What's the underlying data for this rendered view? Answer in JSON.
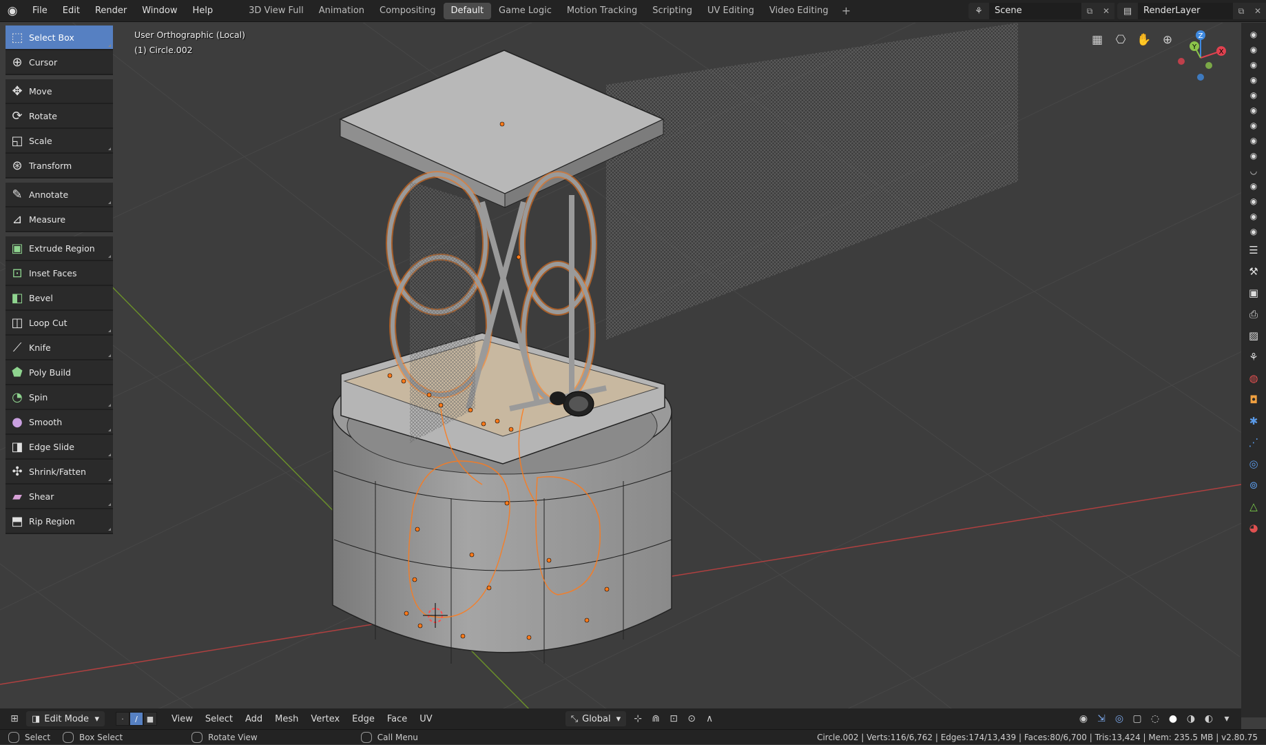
{
  "menu": {
    "items": [
      "File",
      "Edit",
      "Render",
      "Window",
      "Help"
    ]
  },
  "workspaces": {
    "tabs": [
      "3D View Full",
      "Animation",
      "Compositing",
      "Default",
      "Game Logic",
      "Motion Tracking",
      "Scripting",
      "UV Editing",
      "Video Editing"
    ],
    "active": "Default",
    "add_label": "+"
  },
  "scene": {
    "name": "Scene"
  },
  "render_layer": {
    "name": "RenderLayer"
  },
  "viewport": {
    "view_name": "User Orthographic (Local)",
    "object_name": "(1) Circle.002"
  },
  "toolbar": {
    "tools": [
      {
        "label": "Select Box",
        "icon": "select-box-icon"
      },
      {
        "label": "Cursor",
        "icon": "cursor-icon"
      },
      {
        "label": "Move",
        "icon": "move-icon"
      },
      {
        "label": "Rotate",
        "icon": "rotate-icon"
      },
      {
        "label": "Scale",
        "icon": "scale-icon"
      },
      {
        "label": "Transform",
        "icon": "transform-icon"
      },
      {
        "label": "Annotate",
        "icon": "annotate-icon"
      },
      {
        "label": "Measure",
        "icon": "measure-icon"
      },
      {
        "label": "Extrude Region",
        "icon": "extrude-region-icon"
      },
      {
        "label": "Inset Faces",
        "icon": "inset-faces-icon"
      },
      {
        "label": "Bevel",
        "icon": "bevel-icon"
      },
      {
        "label": "Loop Cut",
        "icon": "loop-cut-icon"
      },
      {
        "label": "Knife",
        "icon": "knife-icon"
      },
      {
        "label": "Poly Build",
        "icon": "poly-build-icon"
      },
      {
        "label": "Spin",
        "icon": "spin-icon"
      },
      {
        "label": "Smooth",
        "icon": "smooth-icon"
      },
      {
        "label": "Edge Slide",
        "icon": "edge-slide-icon"
      },
      {
        "label": "Shrink/Fatten",
        "icon": "shrink-fatten-icon"
      },
      {
        "label": "Shear",
        "icon": "shear-icon"
      },
      {
        "label": "Rip Region",
        "icon": "rip-region-icon"
      }
    ],
    "active": "Select Box"
  },
  "gizmo": {
    "x": "X",
    "y": "Y",
    "z": "Z"
  },
  "header": {
    "mode": "Edit Mode",
    "menus": [
      "View",
      "Select",
      "Add",
      "Mesh",
      "Vertex",
      "Edge",
      "Face",
      "UV"
    ],
    "orientation": "Global"
  },
  "status": {
    "select": "Select",
    "box_select": "Box Select",
    "rotate_view": "Rotate View",
    "call_menu": "Call Menu",
    "stats": "Circle.002 | Verts:116/6,762 | Edges:174/13,439 | Faces:80/6,700 | Tris:13,424 | Mem: 235.5 MB | v2.80.75"
  },
  "colors": {
    "accent": "#5680c2",
    "selection": "#ff7a1a",
    "axis_x": "#e0414f",
    "axis_y": "#8bc34a",
    "axis_z": "#3f8ae0"
  }
}
